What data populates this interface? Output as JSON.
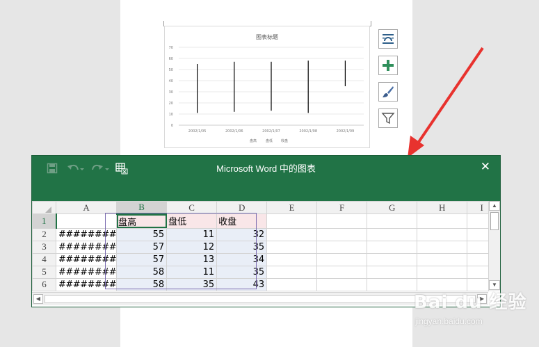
{
  "chart_data": {
    "type": "stock",
    "title": "图表标题",
    "categories": [
      "2002/1/05",
      "2002/1/06",
      "2002/1/07",
      "2002/1/08",
      "2002/1/09"
    ],
    "series": [
      {
        "name": "盘高",
        "values": [
          55,
          57,
          57,
          58,
          58
        ]
      },
      {
        "name": "盘低",
        "values": [
          11,
          12,
          13,
          11,
          35
        ]
      },
      {
        "name": "收盘",
        "values": [
          32,
          35,
          34,
          35,
          43
        ]
      }
    ],
    "y_ticks": [
      "0",
      "10",
      "20",
      "30",
      "40",
      "50",
      "60",
      "70"
    ],
    "ylim": [
      0,
      70
    ],
    "grid": true,
    "legend": "bottom"
  },
  "side_buttons": [
    {
      "icon": "layout-options-icon"
    },
    {
      "icon": "plus-icon"
    },
    {
      "icon": "brush-icon"
    },
    {
      "icon": "filter-icon"
    }
  ],
  "excel": {
    "title": "Microsoft Word 中的图表",
    "close": "✕",
    "columns": [
      "A",
      "B",
      "C",
      "D",
      "E",
      "F",
      "G",
      "H",
      "I"
    ],
    "rows": [
      {
        "n": "1",
        "a": "",
        "b": "盘高",
        "c": "盘低",
        "d": "收盘"
      },
      {
        "n": "2",
        "a": "########",
        "b": "55",
        "c": "11",
        "d": "32"
      },
      {
        "n": "3",
        "a": "########",
        "b": "57",
        "c": "12",
        "d": "35"
      },
      {
        "n": "4",
        "a": "########",
        "b": "57",
        "c": "13",
        "d": "34"
      },
      {
        "n": "5",
        "a": "########",
        "b": "58",
        "c": "11",
        "d": "35"
      },
      {
        "n": "6",
        "a": "########",
        "b": "58",
        "c": "35",
        "d": "43"
      }
    ]
  },
  "watermark": {
    "logo": "Bai du 经验",
    "sub": "jingyan.baidu.com"
  },
  "colors": {
    "excel_green": "#217346",
    "arrow_red": "#e8322e",
    "stock_line": "#000000"
  }
}
